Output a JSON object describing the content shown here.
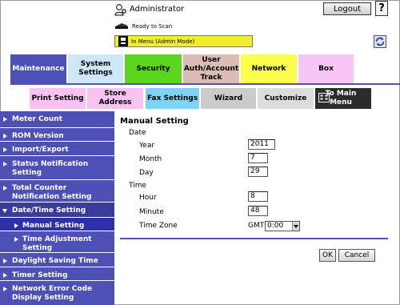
{
  "header": {
    "user": "Administrator",
    "logout_label": "Logout",
    "help_label": "?",
    "status": "Ready to Scan",
    "mode": "In Menu (Admin Mode)"
  },
  "main_tabs": [
    {
      "label": "Maintenance",
      "color": "#4e50b5",
      "selected": true
    },
    {
      "label": "System Settings",
      "color": "#cde6f8"
    },
    {
      "label": "Security",
      "color": "#5cd61c"
    },
    {
      "label": "User Auth/Account Track",
      "color": "#dbbcb4"
    },
    {
      "label": "Network",
      "color": "#fbfe4e"
    },
    {
      "label": "Box",
      "color": "#f7c6f4"
    }
  ],
  "sub_tabs": [
    {
      "label": "Print Setting"
    },
    {
      "label": "Store Address"
    },
    {
      "label": "Fax Settings"
    },
    {
      "label": "Wizard"
    },
    {
      "label": "Customize"
    },
    {
      "label": "To Main Menu"
    }
  ],
  "sidebar": {
    "items": [
      {
        "label": "Meter Count"
      },
      {
        "label": "ROM Version"
      },
      {
        "label": "Import/Export"
      },
      {
        "label": "Status Notification Setting"
      },
      {
        "label": "Total Counter Notification Setting"
      },
      {
        "label": "Date/Time Setting",
        "expanded": true
      },
      {
        "label": "Manual Setting",
        "selected": true
      },
      {
        "label": "Time Adjustment Setting"
      },
      {
        "label": "Daylight Saving Time"
      },
      {
        "label": "Timer Setting"
      },
      {
        "label": "Network Error Code Display Setting"
      }
    ]
  },
  "content": {
    "title": "Manual Setting",
    "date_label": "Date",
    "year_label": "Year",
    "year_value": "2011",
    "month_label": "Month",
    "month_value": "7",
    "day_label": "Day",
    "day_value": "29",
    "time_label": "Time",
    "hour_label": "Hour",
    "hour_value": "8",
    "minute_label": "Minute",
    "minute_value": "48",
    "timezone_label": "Time Zone",
    "gmt_prefix": "GMT",
    "timezone_value": "0:00"
  },
  "buttons": {
    "ok": "OK",
    "cancel": "Cancel"
  },
  "colors": {
    "accent": "#4e50b5",
    "mode_bar": "#f2ee2c"
  }
}
